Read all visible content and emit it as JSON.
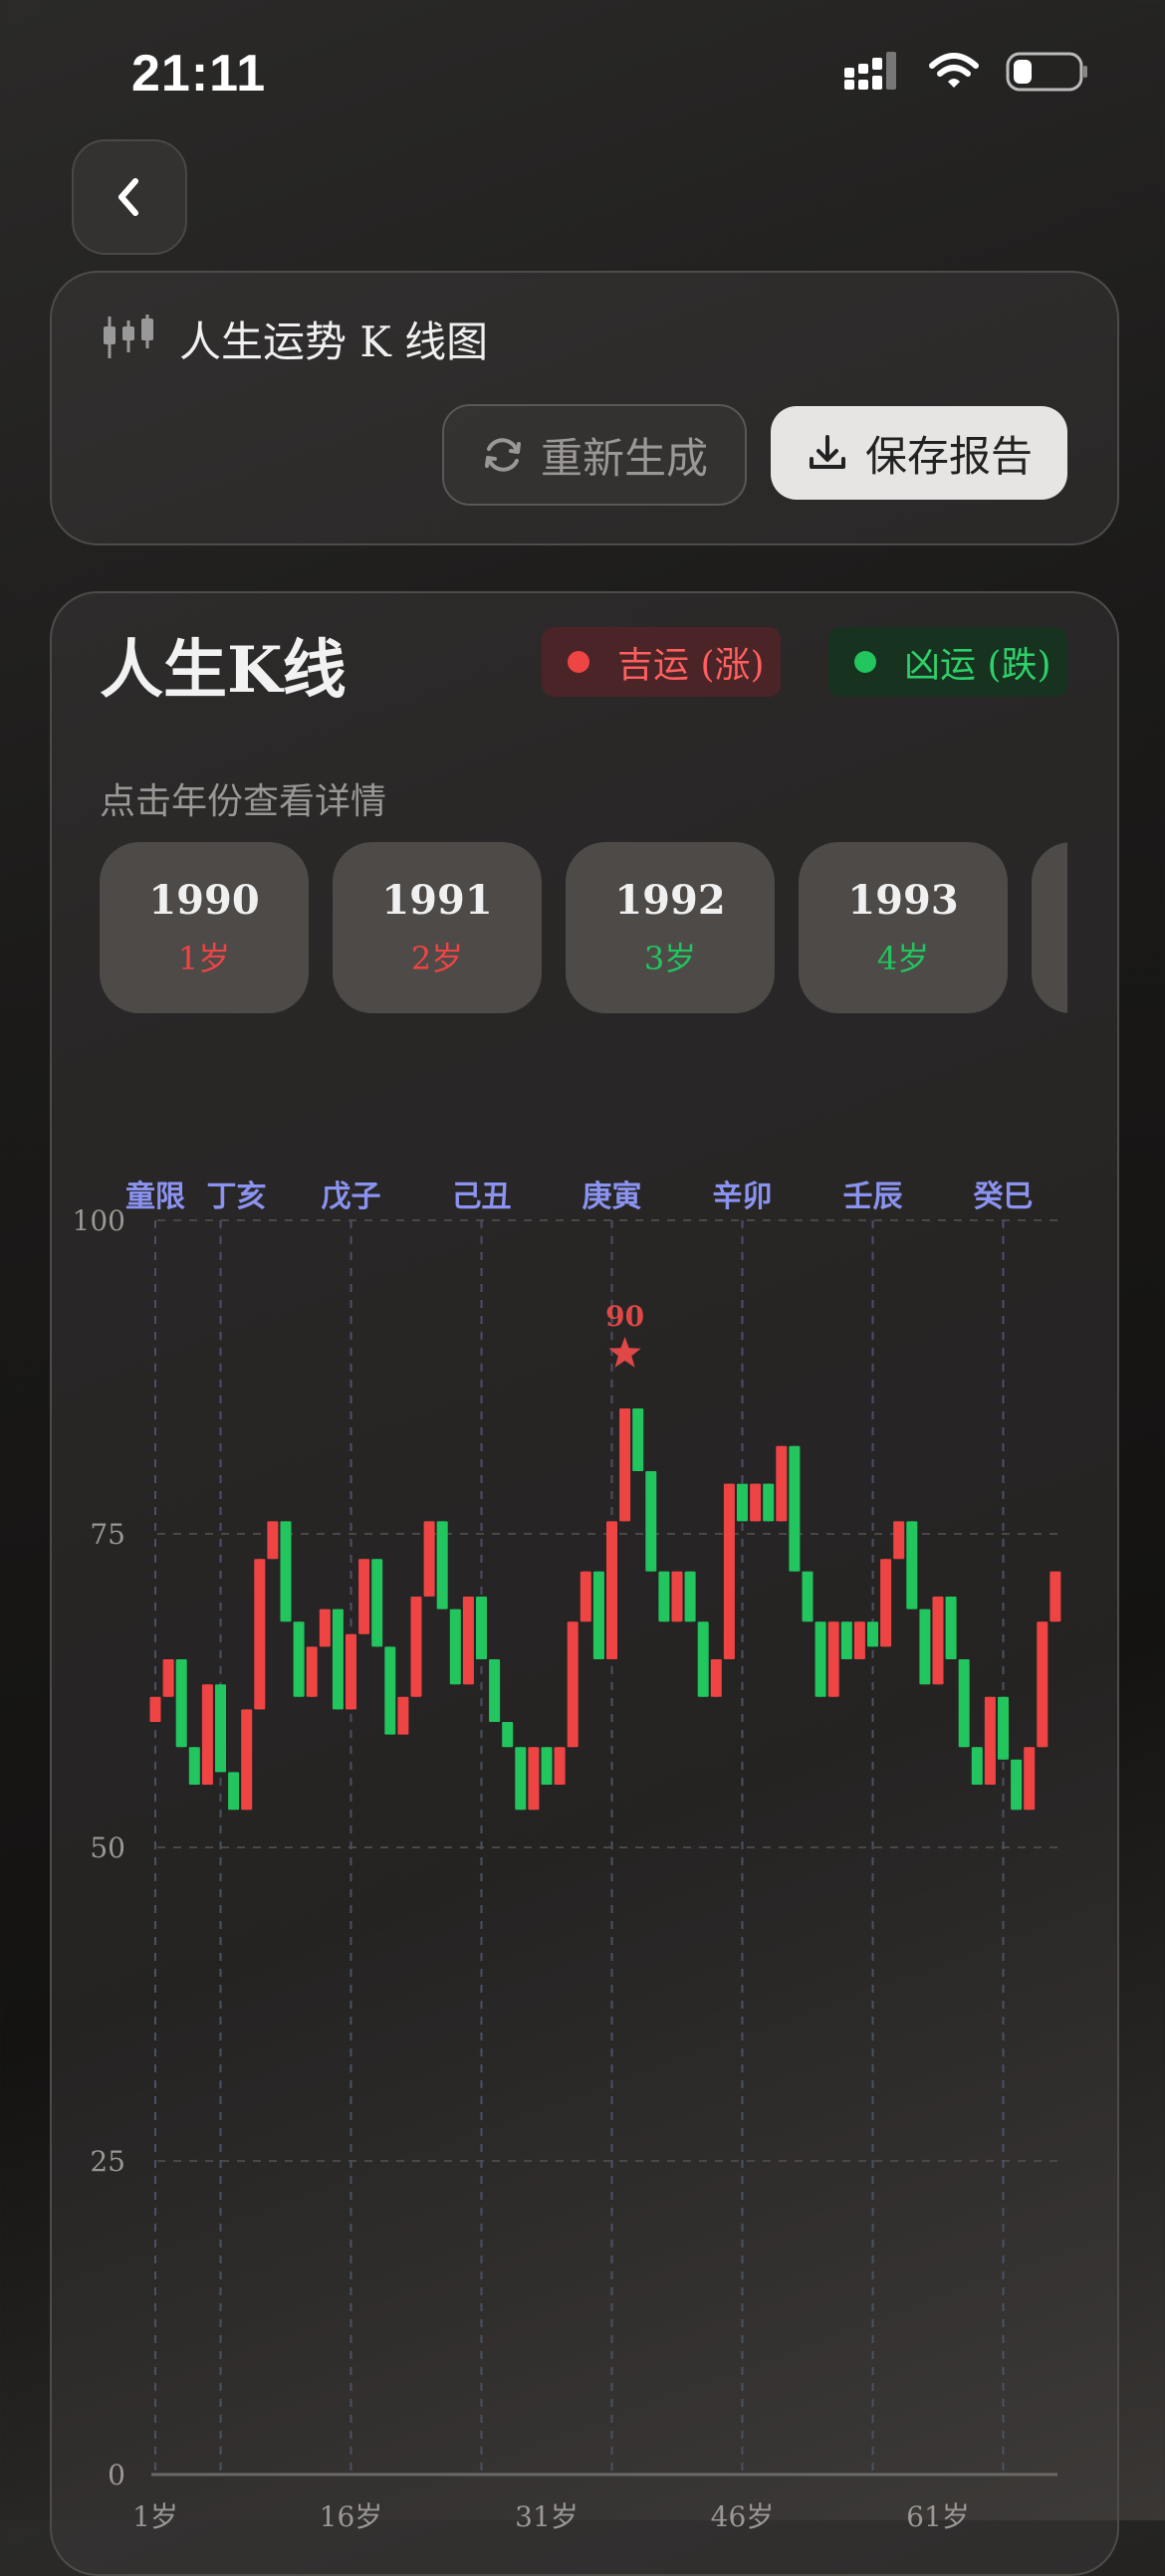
{
  "status": {
    "time": "21:11"
  },
  "header": {
    "title": "人生运势 K 线图",
    "regen_label": "重新生成",
    "save_label": "保存报告"
  },
  "panel": {
    "title": "人生K线",
    "legend_up": "吉运 (涨)",
    "legend_down": "凶运 (跌)",
    "hint": "点击年份查看详情",
    "years": [
      {
        "year": "1990",
        "age": "1岁",
        "trend": "up"
      },
      {
        "year": "1991",
        "age": "2岁",
        "trend": "up"
      },
      {
        "year": "1992",
        "age": "3岁",
        "trend": "down"
      },
      {
        "year": "1993",
        "age": "4岁",
        "trend": "down"
      }
    ]
  },
  "colors": {
    "up": "#ef4444",
    "down": "#22c55e",
    "period": "#8b93f0",
    "peak": "#e04848"
  },
  "chart_data": {
    "type": "candlestick",
    "ylim": [
      0,
      100
    ],
    "yticks": [
      0,
      25,
      50,
      75,
      100
    ],
    "xticks": [
      "1岁",
      "16岁",
      "31岁",
      "46岁",
      "61岁"
    ],
    "xtick_ages": [
      1,
      16,
      31,
      46,
      61
    ],
    "periods": [
      {
        "label": "童限",
        "age": 1
      },
      {
        "label": "丁亥",
        "age": 6
      },
      {
        "label": "戊子",
        "age": 16
      },
      {
        "label": "己丑",
        "age": 26
      },
      {
        "label": "庚寅",
        "age": 36
      },
      {
        "label": "辛卯",
        "age": 46
      },
      {
        "label": "壬辰",
        "age": 56
      },
      {
        "label": "癸巳",
        "age": 66
      }
    ],
    "peak": {
      "age": 37,
      "value": 90,
      "label": "90"
    },
    "candles": [
      [
        60,
        62,
        60,
        62
      ],
      [
        62,
        65,
        62,
        65
      ],
      [
        65,
        58,
        58,
        65
      ],
      [
        58,
        55,
        55,
        58
      ],
      [
        55,
        63,
        55,
        63
      ],
      [
        63,
        56,
        56,
        63
      ],
      [
        56,
        53,
        53,
        56
      ],
      [
        53,
        61,
        53,
        61
      ],
      [
        61,
        73,
        61,
        73
      ],
      [
        73,
        76,
        73,
        76
      ],
      [
        76,
        68,
        68,
        76
      ],
      [
        68,
        62,
        62,
        68
      ],
      [
        62,
        66,
        62,
        66
      ],
      [
        66,
        69,
        66,
        69
      ],
      [
        69,
        61,
        61,
        69
      ],
      [
        61,
        67,
        61,
        67
      ],
      [
        67,
        73,
        67,
        73
      ],
      [
        73,
        66,
        66,
        73
      ],
      [
        66,
        59,
        59,
        66
      ],
      [
        59,
        62,
        59,
        62
      ],
      [
        62,
        70,
        62,
        70
      ],
      [
        70,
        76,
        70,
        76
      ],
      [
        76,
        69,
        69,
        76
      ],
      [
        69,
        63,
        63,
        69
      ],
      [
        63,
        70,
        63,
        70
      ],
      [
        70,
        65,
        65,
        70
      ],
      [
        65,
        60,
        60,
        65
      ],
      [
        60,
        58,
        58,
        60
      ],
      [
        58,
        53,
        53,
        58
      ],
      [
        53,
        58,
        53,
        58
      ],
      [
        58,
        55,
        55,
        58
      ],
      [
        55,
        58,
        55,
        58
      ],
      [
        58,
        68,
        58,
        68
      ],
      [
        68,
        72,
        68,
        72
      ],
      [
        72,
        65,
        65,
        72
      ],
      [
        65,
        76,
        65,
        76
      ],
      [
        76,
        85,
        76,
        85
      ],
      [
        85,
        80,
        80,
        85
      ],
      [
        80,
        72,
        72,
        80
      ],
      [
        72,
        68,
        68,
        72
      ],
      [
        68,
        72,
        68,
        72
      ],
      [
        72,
        68,
        68,
        72
      ],
      [
        68,
        62,
        62,
        68
      ],
      [
        62,
        65,
        62,
        65
      ],
      [
        65,
        79,
        65,
        79
      ],
      [
        79,
        76,
        76,
        79
      ],
      [
        76,
        79,
        76,
        79
      ],
      [
        79,
        76,
        76,
        79
      ],
      [
        76,
        82,
        76,
        82
      ],
      [
        82,
        72,
        72,
        82
      ],
      [
        72,
        68,
        68,
        72
      ],
      [
        68,
        62,
        62,
        68
      ],
      [
        62,
        68,
        62,
        68
      ],
      [
        68,
        65,
        65,
        68
      ],
      [
        65,
        68,
        65,
        68
      ],
      [
        68,
        66,
        66,
        68
      ],
      [
        66,
        73,
        66,
        73
      ],
      [
        73,
        76,
        73,
        76
      ],
      [
        76,
        69,
        69,
        76
      ],
      [
        69,
        63,
        63,
        69
      ],
      [
        63,
        70,
        63,
        70
      ],
      [
        70,
        65,
        65,
        70
      ],
      [
        65,
        58,
        58,
        65
      ],
      [
        58,
        55,
        55,
        58
      ],
      [
        55,
        62,
        55,
        62
      ],
      [
        62,
        57,
        57,
        62
      ],
      [
        57,
        53,
        53,
        57
      ],
      [
        53,
        58,
        53,
        58
      ],
      [
        58,
        68,
        58,
        68
      ],
      [
        68,
        72,
        68,
        72
      ]
    ]
  }
}
